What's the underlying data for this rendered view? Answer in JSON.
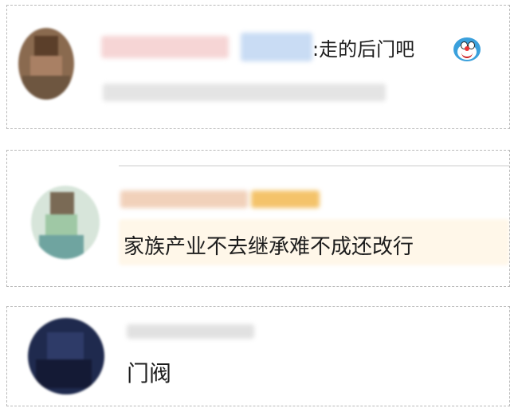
{
  "comments": [
    {
      "text": ":走的后门吧",
      "emoji": "doraemon-emoji"
    },
    {
      "text": "家族产业不去继承难不成还改行"
    },
    {
      "text": "门阀"
    }
  ]
}
